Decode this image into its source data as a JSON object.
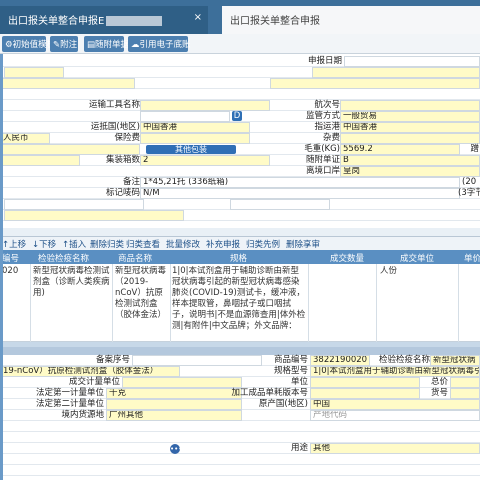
{
  "tabs": [
    {
      "label": "出口报关单整合申报E",
      "close": "×"
    },
    {
      "label": "出口报关单整合申报"
    }
  ],
  "toolbar": [
    "初始值模板",
    "附注",
    "随附单据",
    "引用电子底账"
  ],
  "form": {
    "declare_date_label": "申报日期",
    "transport_label": "运输工具名称",
    "voyage_label": "航次号",
    "supervision_label": "监管方式",
    "supervision_value": "一般贸易",
    "trade_country_label": "运抵国(地区)",
    "trade_country_value": "中国香港",
    "dest_port_label": "指运港",
    "dest_port_value": "中国香港",
    "city_text": "人民币",
    "insurance_label": "保险费",
    "misc_label": "杂费",
    "other_pack_btn": "其他包装",
    "gross_label": "毛重(KG)",
    "gross_value": "5569.2",
    "truncated_label": "蹭",
    "container_count_label": "集装箱数",
    "container_count_value": "2",
    "attached_label": "随附单证",
    "attached_value": "B",
    "exit_port_label": "离境口岸",
    "exit_port_value": "皇岗",
    "remark_label": "备注",
    "remark_value": "1*45,21托 (336纸箱)",
    "remark_extra": "(20",
    "mark_label": "标记唛码",
    "mark_value": "N/M",
    "mark_extra": "(3字节"
  },
  "grid_toolbar": [
    "上移",
    "下移",
    "插入",
    "删除归类",
    "归类查看",
    "批量修改",
    "补充申报",
    "归类先例",
    "删除享审"
  ],
  "grid_headers": [
    "编号",
    "检验检疫名称",
    "商品名称",
    "规格",
    "成交数量",
    "成交单位",
    "单价"
  ],
  "grid_row": {
    "no": "020",
    "inspection_name": "新型冠状病毒检测试剂盒（诊断人类疾病用)",
    "goods_name": "新型冠状病毒（2019-nCoV）抗原检测试剂盒（胶体金法）",
    "spec": "1|0|本试剂盒用于辅助诊断由新型冠状病毒引起的新型冠状病毒感染肺炎(COVID-19)测试卡，缓冲液，样本提取管，鼻咽拭子或口咽拭子，说明书|不是血源筛查用|体外检测|有附件|中文品牌；外文品牌：",
    "unit": "人份"
  },
  "detail": {
    "record_label": "备案序号",
    "goods_code_label": "商品编号",
    "goods_code_value": "3822190020",
    "inspect_name_label": "检验检疫名称",
    "inspect_name_value": "新型冠状病",
    "trade_name_value": "19-nCoV）抗原检测试剂盒（胶体金法）",
    "spec_label": "规格型号",
    "spec_value": "1|0|本试剂盒用于辅助诊断由新型冠状病毒引起的",
    "deal_unit_label": "成交计量单位",
    "unit_label": "单位",
    "total_label": "总价",
    "legal_first_label": "法定第一计量单位",
    "legal_first_value": "千克",
    "processing_label": "加工成品单耗版本号",
    "cargo_no_label": "货号",
    "legal_second_label": "法定第二计量单位",
    "origin_country_label": "原产国(地区)",
    "origin_country_value": "中国",
    "domestic_source_label": "境内货源地",
    "domestic_source_value": "广州其他",
    "place_hint": "产地代码",
    "usage_label": "用途",
    "usage_value": "其他"
  }
}
